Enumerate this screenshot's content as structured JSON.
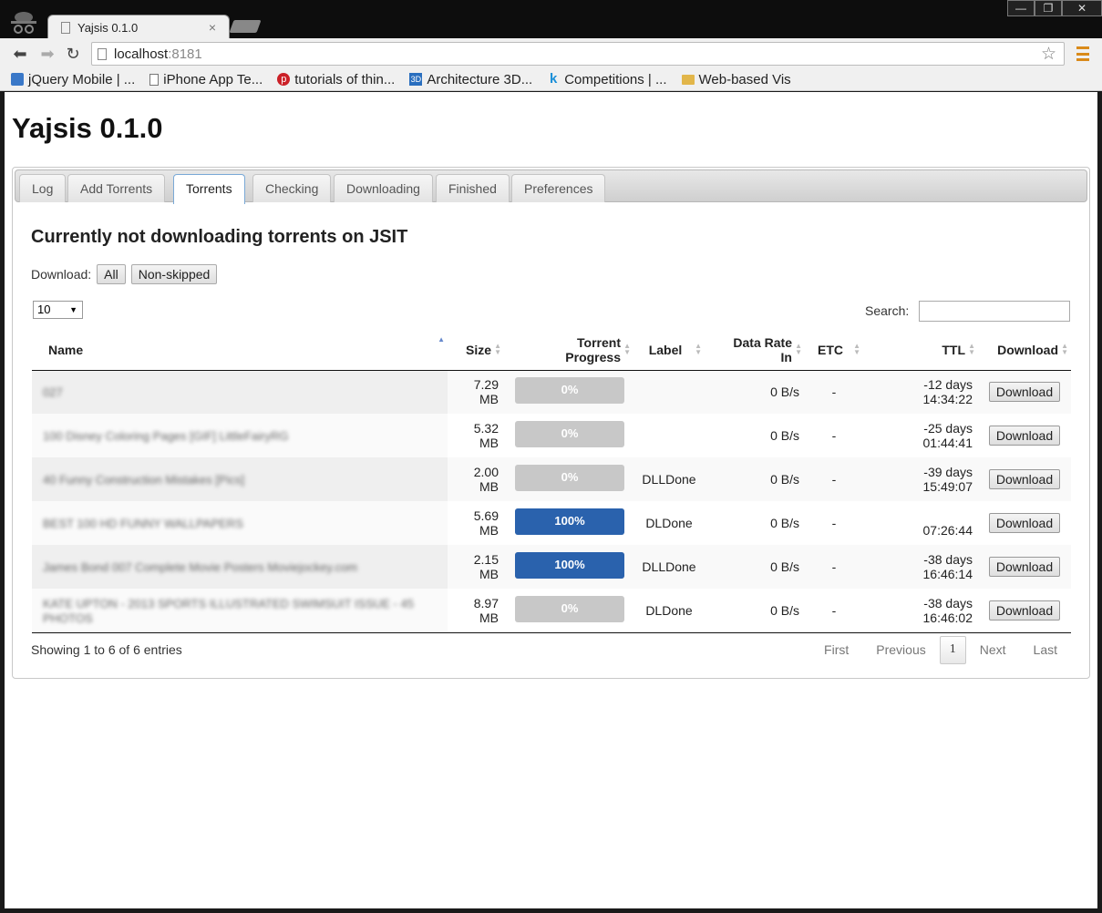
{
  "browser": {
    "tab_title": "Yajsis 0.1.0",
    "tab_close": "×",
    "address_host": "localhost",
    "address_port": ":8181",
    "window_controls": [
      "—",
      "❐",
      "✕"
    ],
    "bookmarks": [
      {
        "label": "jQuery Mobile | ...",
        "icon": "jquery-icon",
        "color": "#3a78c8"
      },
      {
        "label": "iPhone App Te...",
        "icon": "page-icon",
        "color": "#888888"
      },
      {
        "label": "tutorials of thin...",
        "icon": "pinterest-icon",
        "color": "#cb2027"
      },
      {
        "label": "Architecture 3D...",
        "icon": "3d-icon",
        "color": "#2a6fbf"
      },
      {
        "label": "Competitions | ...",
        "icon": "k-icon",
        "color": "#1a8fd8"
      },
      {
        "label": "Web-based Vis",
        "icon": "folder-icon",
        "color": "#e2b64a"
      }
    ]
  },
  "page": {
    "title": "Yajsis 0.1.0",
    "tabs": [
      "Log",
      "Add Torrents",
      "Torrents",
      "Checking",
      "Downloading",
      "Finished",
      "Preferences"
    ],
    "active_tab": "Torrents",
    "heading": "Currently not downloading torrents on JSIT",
    "download_label": "Download:",
    "download_all": "All",
    "download_nonskipped": "Non-skipped",
    "page_length": "10",
    "search_label": "Search:",
    "search_value": "",
    "columns": [
      "Name",
      "Size",
      "Torrent Progress",
      "Label",
      "Data Rate In",
      "ETC",
      "TTL",
      "Download"
    ],
    "columns_split": {
      "progress_1": "Torrent",
      "progress_2": "Progress",
      "rate_1": "Data Rate",
      "rate_2": "In"
    },
    "rows": [
      {
        "name": "027",
        "size_1": "7.29",
        "size_2": "MB",
        "progress": 0,
        "progress_text": "0%",
        "label": "",
        "rate": "0 B/s",
        "etc": "-",
        "ttl_1": "-12 days",
        "ttl_2": "14:34:22",
        "btn": "Download"
      },
      {
        "name": "100 Disney Coloring Pages [GIF] LittleFairyRG",
        "size_1": "5.32",
        "size_2": "MB",
        "progress": 0,
        "progress_text": "0%",
        "label": "",
        "rate": "0 B/s",
        "etc": "-",
        "ttl_1": "-25 days",
        "ttl_2": "01:44:41",
        "btn": "Download"
      },
      {
        "name": "40 Funny Construction Mistakes [Pics]",
        "size_1": "2.00",
        "size_2": "MB",
        "progress": 0,
        "progress_text": "0%",
        "label": "DLLDone",
        "rate": "0 B/s",
        "etc": "-",
        "ttl_1": "-39 days",
        "ttl_2": "15:49:07",
        "btn": "Download"
      },
      {
        "name": "BEST 100 HD FUNNY WALLPAPERS",
        "size_1": "5.69",
        "size_2": "MB",
        "progress": 100,
        "progress_text": "100%",
        "label": "DLDone",
        "rate": "0 B/s",
        "etc": "-",
        "ttl_1": "",
        "ttl_2": "07:26:44",
        "btn": "Download"
      },
      {
        "name": "James Bond 007 Complete Movie Posters Moviejockey.com",
        "size_1": "2.15",
        "size_2": "MB",
        "progress": 100,
        "progress_text": "100%",
        "label": "DLLDone",
        "rate": "0 B/s",
        "etc": "-",
        "ttl_1": "-38 days",
        "ttl_2": "16:46:14",
        "btn": "Download"
      },
      {
        "name": "KATE UPTON - 2013 SPORTS ILLUSTRATED SWIMSUIT ISSUE - 45 PHOTOS",
        "size_1": "8.97",
        "size_2": "MB",
        "progress": 0,
        "progress_text": "0%",
        "label": "DLDone",
        "rate": "0 B/s",
        "etc": "-",
        "ttl_1": "-38 days",
        "ttl_2": "16:46:02",
        "btn": "Download"
      }
    ],
    "info": "Showing 1 to 6 of 6 entries",
    "paging": {
      "first": "First",
      "previous": "Previous",
      "current": "1",
      "next": "Next",
      "last": "Last"
    }
  },
  "colors": {
    "progress_fill": "#2a62ad",
    "progress_empty": "#c8c8c8"
  }
}
